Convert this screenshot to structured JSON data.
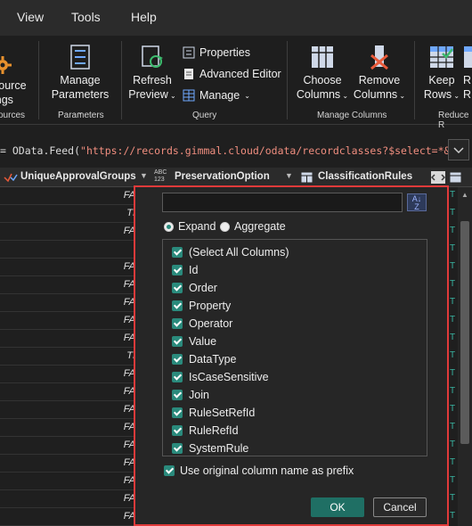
{
  "menu": [
    "View",
    "Tools",
    "Help"
  ],
  "ribbon": {
    "data_sources": {
      "label_line1": "source",
      "label_line2": "ings",
      "group": "ources"
    },
    "manage_parameters": {
      "line1": "Manage",
      "line2": "Parameters",
      "group": "Parameters"
    },
    "refresh_preview": {
      "line1": "Refresh",
      "line2": "Preview"
    },
    "properties": "Properties",
    "advanced_editor": "Advanced Editor",
    "manage": "Manage",
    "query_group": "Query",
    "choose_columns": {
      "line1": "Choose",
      "line2": "Columns"
    },
    "remove_columns": {
      "line1": "Remove",
      "line2": "Columns"
    },
    "manage_columns_group": "Manage Columns",
    "keep_rows": {
      "line1": "Keep",
      "line2": "Rows"
    },
    "r_next": {
      "line1": "R",
      "line2": "R"
    },
    "reduce_group": "Reduce R"
  },
  "formula": {
    "prefix": "= OData.Feed(",
    "string": "\"https://records.gimmal.cloud/odata/recordclasses?$select=*&"
  },
  "columns": {
    "unique_approval_groups": "UniqueApprovalGroups",
    "preservation_option": "PreservationOption",
    "abc_top": "ABC",
    "abc_bottom": "123",
    "classification_rules": "ClassificationRules"
  },
  "grid_values": [
    "FA",
    "TI",
    "FA",
    "",
    "FA",
    "FA",
    "FA",
    "FA",
    "FA",
    "TI",
    "FA",
    "FA",
    "FA",
    "FA",
    "FA",
    "FA",
    "FA",
    "FA",
    "FA"
  ],
  "popup": {
    "search_value": "",
    "sort_icon_top": "A",
    "sort_icon_bottom": "Z",
    "expand_label": "Expand",
    "aggregate_label": "Aggregate",
    "items": [
      "(Select All Columns)",
      "Id",
      "Order",
      "Property",
      "Operator",
      "Value",
      "DataType",
      "IsCaseSensitive",
      "Join",
      "RuleSetRefId",
      "RuleRefId",
      "SystemRule"
    ],
    "prefix_label": "Use original column name as prefix",
    "ok": "OK",
    "cancel": "Cancel"
  },
  "colors": {
    "accent": "#2a8a7c",
    "highlight_border": "#e03a3a",
    "ok_bg": "#1f6f64"
  }
}
